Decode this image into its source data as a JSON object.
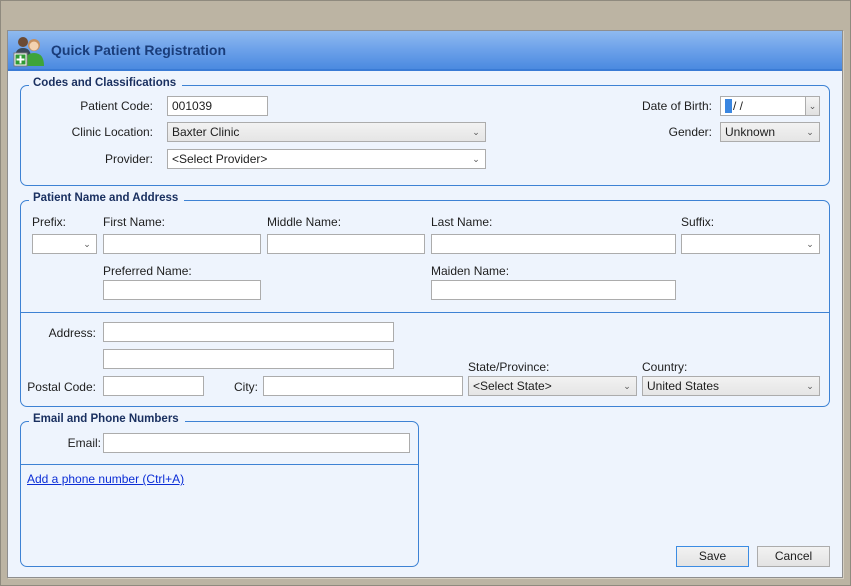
{
  "window": {
    "title": "Quick Patient Registration",
    "icon": "patient-registration-icon"
  },
  "codes": {
    "legend": "Codes and Classifications",
    "patient_code_label": "Patient Code:",
    "patient_code_value": "001039",
    "clinic_location_label": "Clinic Location:",
    "clinic_location_value": "Baxter Clinic",
    "provider_label": "Provider:",
    "provider_value": "<Select Provider>",
    "dob_label": "Date of Birth:",
    "dob_value": "/  /",
    "gender_label": "Gender:",
    "gender_value": "Unknown"
  },
  "name_address": {
    "legend": "Patient Name and Address",
    "prefix_label": "Prefix:",
    "prefix_value": "",
    "first_name_label": "First Name:",
    "first_name_value": "",
    "middle_name_label": "Middle Name:",
    "middle_name_value": "",
    "last_name_label": "Last Name:",
    "last_name_value": "",
    "suffix_label": "Suffix:",
    "suffix_value": "",
    "preferred_name_label": "Preferred Name:",
    "preferred_name_value": "",
    "maiden_name_label": "Maiden Name:",
    "maiden_name_value": "",
    "address_label": "Address:",
    "address1_value": "",
    "address2_value": "",
    "postal_code_label": "Postal Code:",
    "postal_code_value": "",
    "city_label": "City:",
    "city_value": "",
    "state_label": "State/Province:",
    "state_value": "<Select State>",
    "country_label": "Country:",
    "country_value": "United States"
  },
  "contact": {
    "legend": "Email and Phone Numbers",
    "email_label": "Email:",
    "email_value": "",
    "add_phone_link": "Add a phone number (Ctrl+A)"
  },
  "buttons": {
    "save": "Save",
    "cancel": "Cancel"
  },
  "icons": {
    "dropdown": "chevron-down-icon"
  }
}
